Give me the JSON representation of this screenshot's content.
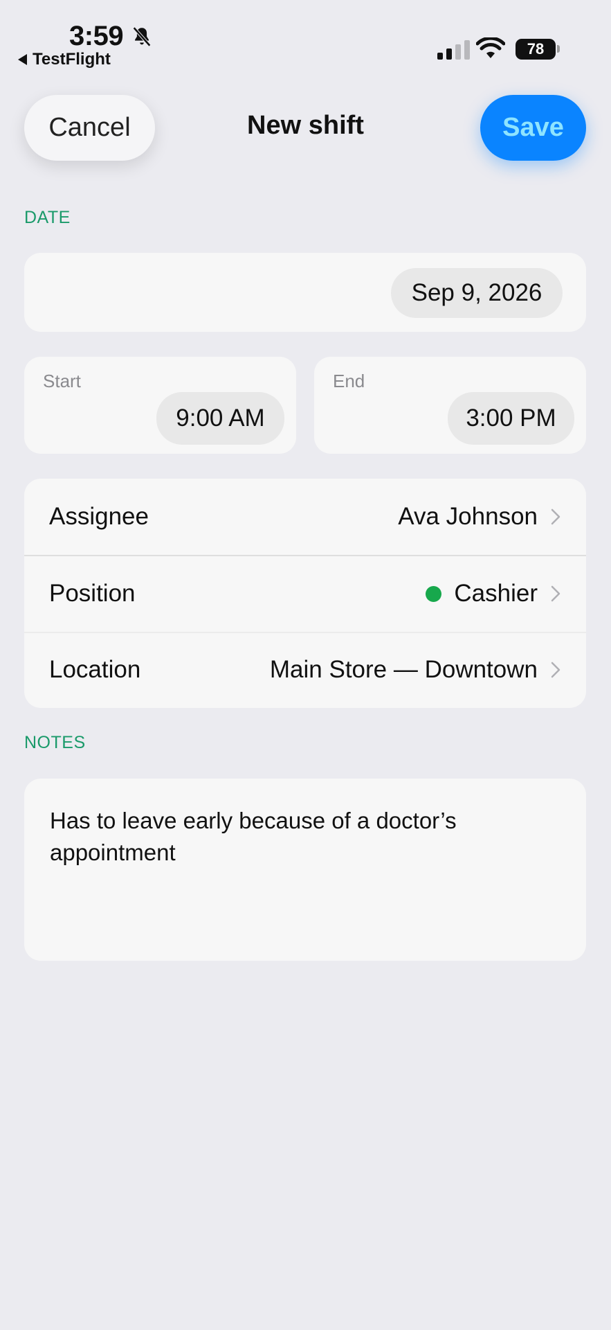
{
  "status_bar": {
    "time": "3:59",
    "back_app": "TestFlight",
    "battery": "78"
  },
  "nav": {
    "cancel_label": "Cancel",
    "title": "New shift",
    "save_label": "Save"
  },
  "date_section": {
    "header": "DATE",
    "date_value": "Sep 9, 2026"
  },
  "time_section": {
    "start_label": "Start",
    "start_value": "9:00 AM",
    "end_label": "End",
    "end_value": "3:00 PM"
  },
  "details": {
    "rows": [
      {
        "label": "Assignee",
        "value": "Ava Johnson"
      },
      {
        "label": "Position",
        "value": "Cashier"
      },
      {
        "label": "Location",
        "value": "Main Store — Downtown"
      }
    ]
  },
  "notes_section": {
    "header": "NOTES",
    "text": "Has to leave early because of a doctor’s appointment"
  },
  "icons": [
    "bell-slash-icon",
    "back-triangle-icon",
    "signal-icon",
    "wifi-icon",
    "battery-icon",
    "chevron-right-icon",
    "position-color-dot"
  ],
  "colors": {
    "accent_blue": "#0a84ff",
    "save_text": "#8ee4ff",
    "section_header_green": "#1a9a6a",
    "position_dot_green": "#17a84c",
    "background": "#ebebf0",
    "card": "#f7f7f7"
  }
}
